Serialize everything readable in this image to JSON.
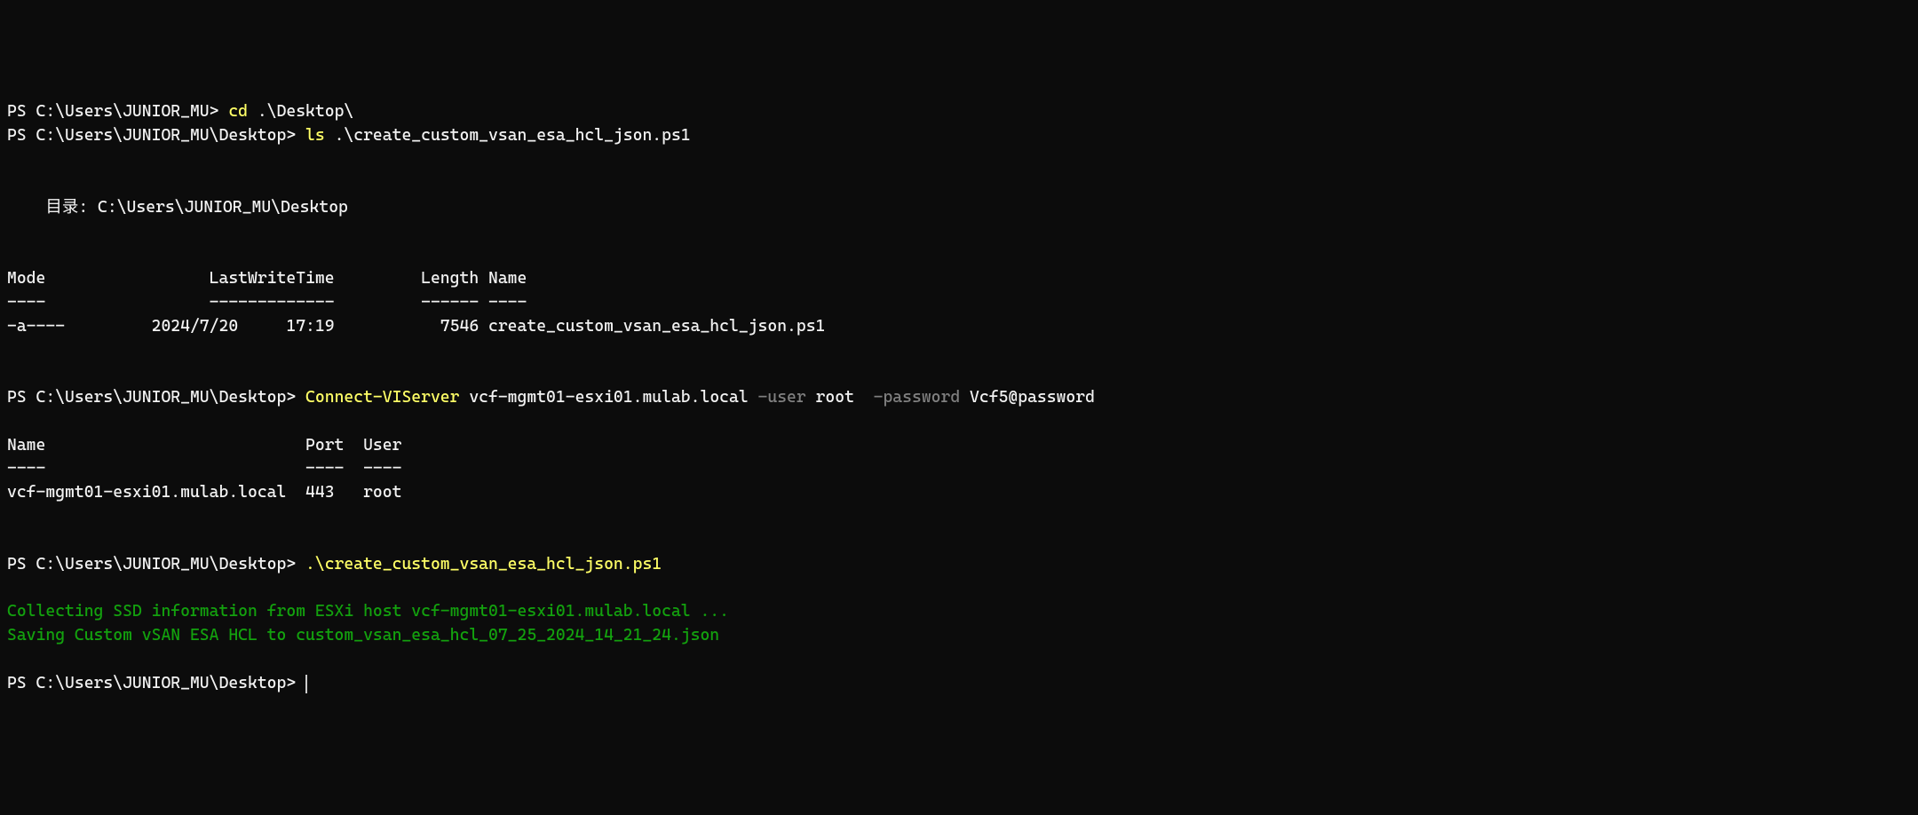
{
  "lines": {
    "l1_prompt": "PS C:\\Users\\JUNIOR_MU> ",
    "l1_cmd": "cd",
    "l1_arg": " .\\Desktop\\",
    "l2_prompt": "PS C:\\Users\\JUNIOR_MU\\Desktop> ",
    "l2_cmd": "ls",
    "l2_arg": " .\\create_custom_vsan_esa_hcl_json.ps1",
    "dir_header": "    目录: C:\\Users\\JUNIOR_MU\\Desktop",
    "tbl_header": "Mode                 LastWriteTime         Length Name",
    "tbl_divider": "----                 -------------         ------ ----",
    "tbl_row": "-a----         2024/7/20     17:19           7546 create_custom_vsan_esa_hcl_json.ps1",
    "l3_prompt": "PS C:\\Users\\JUNIOR_MU\\Desktop> ",
    "l3_cmd": "Connect-VIServer",
    "l3_arg1": " vcf-mgmt01-esxi01.mulab.local ",
    "l3_p1": "-user",
    "l3_v1": " root  ",
    "l3_p2": "-password",
    "l3_v2": " Vcf5@password",
    "conn_header": "Name                           Port  User",
    "conn_div": "----                           ----  ----",
    "conn_row": "vcf-mgmt01-esxi01.mulab.local  443   root",
    "l4_prompt": "PS C:\\Users\\JUNIOR_MU\\Desktop> ",
    "l4_cmd": ".\\create_custom_vsan_esa_hcl_json.ps1",
    "out1": "Collecting SSD information from ESXi host vcf-mgmt01-esxi01.mulab.local ...",
    "out2": "Saving Custom vSAN ESA HCL to custom_vsan_esa_hcl_07_25_2024_14_21_24.json",
    "l5_prompt": "PS C:\\Users\\JUNIOR_MU\\Desktop> "
  }
}
